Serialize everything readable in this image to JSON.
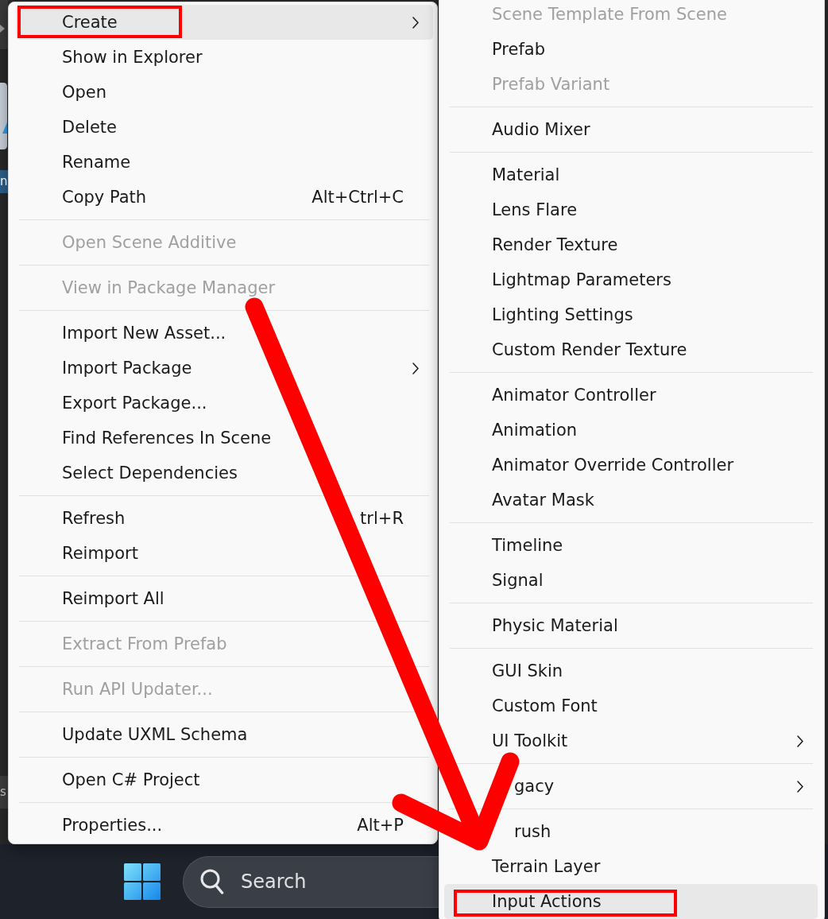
{
  "editor_edge": {
    "items": [
      {
        "text": "n",
        "selected": true
      },
      {
        "text": "s",
        "selected": false
      }
    ]
  },
  "context_menu": {
    "sections": [
      {
        "items": [
          {
            "label": "Create",
            "disabled": false,
            "highlighted": true,
            "submenu": true,
            "marked": true
          },
          {
            "label": "Show in Explorer",
            "disabled": false,
            "highlighted": false,
            "submenu": false,
            "marked": false
          },
          {
            "label": "Open",
            "disabled": false,
            "highlighted": false,
            "submenu": false,
            "marked": false
          },
          {
            "label": "Delete",
            "disabled": false,
            "highlighted": false,
            "submenu": false,
            "marked": false
          },
          {
            "label": "Rename",
            "disabled": false,
            "highlighted": false,
            "submenu": false,
            "marked": false
          },
          {
            "label": "Copy Path",
            "shortcut": "Alt+Ctrl+C",
            "disabled": false,
            "highlighted": false,
            "submenu": false,
            "marked": false
          }
        ]
      },
      {
        "items": [
          {
            "label": "Open Scene Additive",
            "disabled": true,
            "highlighted": false,
            "submenu": false,
            "marked": false
          }
        ]
      },
      {
        "items": [
          {
            "label": "View in Package Manager",
            "disabled": true,
            "highlighted": false,
            "submenu": false,
            "marked": false
          }
        ]
      },
      {
        "items": [
          {
            "label": "Import New Asset...",
            "disabled": false,
            "highlighted": false,
            "submenu": false,
            "marked": false
          },
          {
            "label": "Import Package",
            "disabled": false,
            "highlighted": false,
            "submenu": true,
            "marked": false
          },
          {
            "label": "Export Package...",
            "disabled": false,
            "highlighted": false,
            "submenu": false,
            "marked": false
          },
          {
            "label": "Find References In Scene",
            "disabled": false,
            "highlighted": false,
            "submenu": false,
            "marked": false
          },
          {
            "label": "Select Dependencies",
            "disabled": false,
            "highlighted": false,
            "submenu": false,
            "marked": false
          }
        ]
      },
      {
        "items": [
          {
            "label": "Refresh",
            "shortcut": "trl+R",
            "disabled": false,
            "highlighted": false,
            "submenu": false,
            "marked": false
          },
          {
            "label": "Reimport",
            "disabled": false,
            "highlighted": false,
            "submenu": false,
            "marked": false
          }
        ]
      },
      {
        "items": [
          {
            "label": "Reimport All",
            "disabled": false,
            "highlighted": false,
            "submenu": false,
            "marked": false
          }
        ]
      },
      {
        "items": [
          {
            "label": "Extract From Prefab",
            "disabled": true,
            "highlighted": false,
            "submenu": false,
            "marked": false
          }
        ]
      },
      {
        "items": [
          {
            "label": "Run API Updater...",
            "disabled": true,
            "highlighted": false,
            "submenu": false,
            "marked": false
          }
        ]
      },
      {
        "items": [
          {
            "label": "Update UXML Schema",
            "disabled": false,
            "highlighted": false,
            "submenu": false,
            "marked": false
          }
        ]
      },
      {
        "items": [
          {
            "label": "Open C# Project",
            "disabled": false,
            "highlighted": false,
            "submenu": false,
            "marked": false
          }
        ]
      },
      {
        "items": [
          {
            "label": "Properties...",
            "shortcut": "Alt+P",
            "disabled": false,
            "highlighted": false,
            "submenu": false,
            "marked": false
          }
        ]
      }
    ]
  },
  "create_submenu": {
    "sections": [
      {
        "items": [
          {
            "label": "Scene Template From Scene",
            "disabled": true,
            "highlighted": false,
            "submenu": false,
            "marked": false,
            "obscured": false
          },
          {
            "label": "Prefab",
            "disabled": false,
            "highlighted": false,
            "submenu": false,
            "marked": false,
            "obscured": false
          },
          {
            "label": "Prefab Variant",
            "disabled": true,
            "highlighted": false,
            "submenu": false,
            "marked": false,
            "obscured": false
          }
        ]
      },
      {
        "items": [
          {
            "label": "Audio Mixer",
            "disabled": false,
            "highlighted": false,
            "submenu": false,
            "marked": false,
            "obscured": false
          }
        ]
      },
      {
        "items": [
          {
            "label": "Material",
            "disabled": false,
            "highlighted": false,
            "submenu": false,
            "marked": false,
            "obscured": false
          },
          {
            "label": "Lens Flare",
            "disabled": false,
            "highlighted": false,
            "submenu": false,
            "marked": false,
            "obscured": false
          },
          {
            "label": "Render Texture",
            "disabled": false,
            "highlighted": false,
            "submenu": false,
            "marked": false,
            "obscured": false
          },
          {
            "label": "Lightmap Parameters",
            "disabled": false,
            "highlighted": false,
            "submenu": false,
            "marked": false,
            "obscured": false
          },
          {
            "label": "Lighting Settings",
            "disabled": false,
            "highlighted": false,
            "submenu": false,
            "marked": false,
            "obscured": false
          },
          {
            "label": "Custom Render Texture",
            "disabled": false,
            "highlighted": false,
            "submenu": false,
            "marked": false,
            "obscured": false
          }
        ]
      },
      {
        "items": [
          {
            "label": "Animator Controller",
            "disabled": false,
            "highlighted": false,
            "submenu": false,
            "marked": false,
            "obscured": false
          },
          {
            "label": "Animation",
            "disabled": false,
            "highlighted": false,
            "submenu": false,
            "marked": false,
            "obscured": false
          },
          {
            "label": "Animator Override Controller",
            "disabled": false,
            "highlighted": false,
            "submenu": false,
            "marked": false,
            "obscured": false
          },
          {
            "label": "Avatar Mask",
            "disabled": false,
            "highlighted": false,
            "submenu": false,
            "marked": false,
            "obscured": false
          }
        ]
      },
      {
        "items": [
          {
            "label": "Timeline",
            "disabled": false,
            "highlighted": false,
            "submenu": false,
            "marked": false,
            "obscured": false
          },
          {
            "label": "Signal",
            "disabled": false,
            "highlighted": false,
            "submenu": false,
            "marked": false,
            "obscured": false
          }
        ]
      },
      {
        "items": [
          {
            "label": "Physic Material",
            "disabled": false,
            "highlighted": false,
            "submenu": false,
            "marked": false,
            "obscured": false
          }
        ]
      },
      {
        "items": [
          {
            "label": "GUI Skin",
            "disabled": false,
            "highlighted": false,
            "submenu": false,
            "marked": false,
            "obscured": false
          },
          {
            "label": "Custom Font",
            "disabled": false,
            "highlighted": false,
            "submenu": false,
            "marked": false,
            "obscured": false
          },
          {
            "label": "UI Toolkit",
            "disabled": false,
            "highlighted": false,
            "submenu": true,
            "marked": false,
            "obscured": false
          }
        ]
      },
      {
        "items": [
          {
            "label": "gacy",
            "disabled": false,
            "highlighted": false,
            "submenu": true,
            "marked": false,
            "obscured": true
          }
        ]
      },
      {
        "items": [
          {
            "label": "rush",
            "disabled": false,
            "highlighted": false,
            "submenu": false,
            "marked": false,
            "obscured": true
          },
          {
            "label": "Terrain Layer",
            "disabled": false,
            "highlighted": false,
            "submenu": false,
            "marked": false,
            "obscured": false
          },
          {
            "label": "Input Actions",
            "disabled": false,
            "highlighted": true,
            "submenu": false,
            "marked": true,
            "obscured": false
          }
        ]
      }
    ]
  },
  "taskbar": {
    "search": {
      "placeholder": "Search"
    }
  }
}
